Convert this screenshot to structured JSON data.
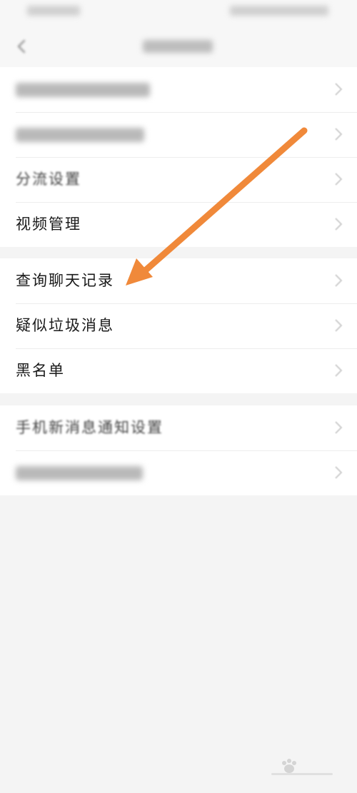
{
  "menu": {
    "visible_items": [
      {
        "label": "分流设置"
      },
      {
        "label": "视频管理"
      },
      {
        "label": "查询聊天记录"
      },
      {
        "label": "疑似垃圾消息"
      },
      {
        "label": "黑名单"
      },
      {
        "label": "手机新消息通知设置"
      }
    ]
  },
  "colors": {
    "arrow": "#f0893a",
    "background": "#f4f4f4",
    "row_bg": "#ffffff"
  },
  "icons": {
    "back": "back-arrow-icon",
    "row_chevron": "chevron-right-icon",
    "annotation": "pointer-arrow-icon"
  }
}
